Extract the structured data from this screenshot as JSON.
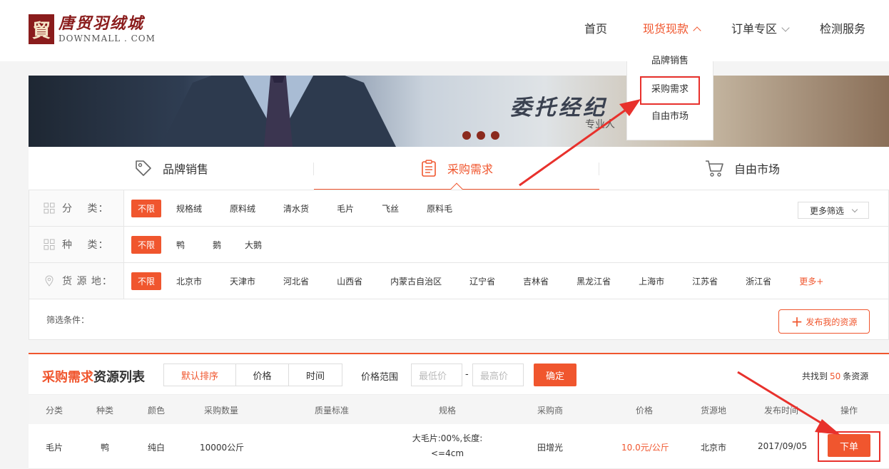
{
  "logo": {
    "mark": "貿",
    "cn": "唐贸羽绒城",
    "en": "DOWNMALL . COM"
  },
  "nav": {
    "home": "首页",
    "spot": "现货现款",
    "order": "订单专区",
    "test": "检测服务"
  },
  "dropdown": [
    "品牌销售",
    "采购需求",
    "自由市场"
  ],
  "banner": {
    "text": "委托经纪",
    "sub": "专业人"
  },
  "tabs": [
    "品牌销售",
    "采购需求",
    "自由市场"
  ],
  "filter": {
    "category": {
      "label": "分　 类：",
      "options": [
        "不限",
        "规格绒",
        "原料绒",
        "清水货",
        "毛片",
        "飞丝",
        "原料毛"
      ]
    },
    "species": {
      "label": "种　 类：",
      "options": [
        "不限",
        "鸭",
        "鹅",
        "大鹅"
      ]
    },
    "origin": {
      "label": "货 源 地：",
      "options": [
        "不限",
        "北京市",
        "天津市",
        "河北省",
        "山西省",
        "内蒙古自治区",
        "辽宁省",
        "吉林省",
        "黑龙江省",
        "上海市",
        "江苏省",
        "浙江省",
        "更多+"
      ]
    },
    "more_filter": "更多筛选",
    "conditions": "筛选条件：",
    "publish": "发布我的资源"
  },
  "list": {
    "title_hl": "采购需求",
    "title_rest": "资源列表",
    "sort": [
      "默认排序",
      "价格",
      "时间"
    ],
    "price_range": "价格范围",
    "min_placeholder": "最低价",
    "max_placeholder": "最高价",
    "confirm": "确定",
    "found_prefix": "共找到",
    "found_count": "50",
    "found_suffix": "条资源",
    "headers": [
      "分类",
      "种类",
      "颜色",
      "采购数量",
      "质量标准",
      "规格",
      "采购商",
      "价格",
      "货源地",
      "发布时间",
      "操作"
    ],
    "rows": [
      {
        "category": "毛片",
        "species": "鸭",
        "color": "纯白",
        "quantity": "10000公斤",
        "quality": "",
        "spec": "大毛片:00%,长度:<=4cm",
        "buyer": "田增光",
        "price": "10.0元/公斤",
        "origin": "北京市",
        "date": "2017/09/05",
        "action": "下单"
      }
    ]
  },
  "colors": {
    "accent": "#f0562e",
    "highlight": "#e8312c"
  }
}
